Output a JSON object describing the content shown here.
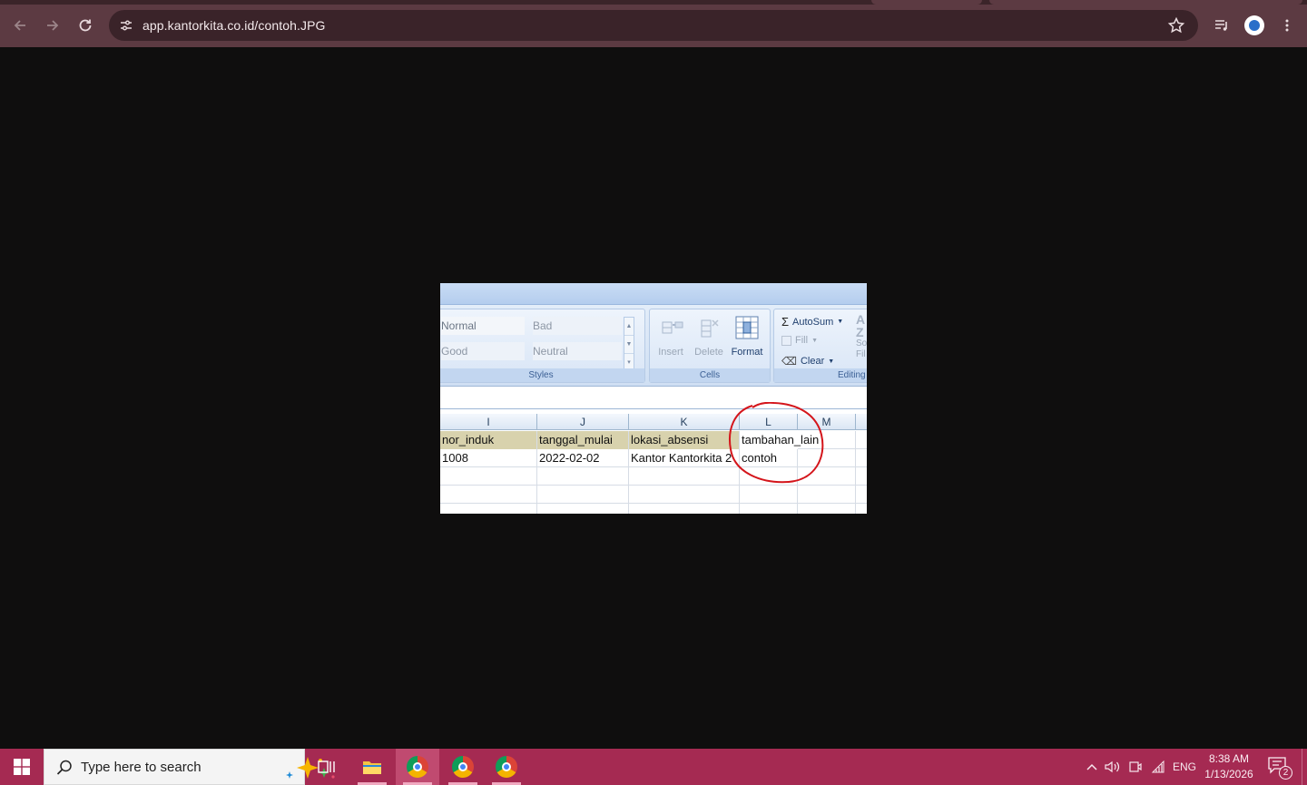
{
  "browser": {
    "url": "app.kantorkita.co.id/contoh.JPG",
    "icons": [
      "back-icon",
      "forward-icon",
      "reload-icon",
      "site-info-icon",
      "bookmark-star-icon",
      "media-control-icon",
      "profile-avatar",
      "menu-kebab-icon"
    ]
  },
  "excel": {
    "ribbon": {
      "styles": {
        "label": "Styles",
        "normal": "Normal",
        "bad": "Bad",
        "good": "Good",
        "neutral": "Neutral"
      },
      "cells": {
        "label": "Cells",
        "insert": "Insert",
        "delete": "Delete",
        "format": "Format"
      },
      "editing": {
        "label": "Editing",
        "autosum": "AutoSum",
        "fill": "Fill",
        "clear": "Clear",
        "sort_partial_1": "So",
        "sort_partial_2": "Fil"
      }
    },
    "columns": [
      "I",
      "J",
      "K",
      "L",
      "M"
    ],
    "header_row": [
      "nor_induk",
      "tanggal_mulai",
      "lokasi_absensi",
      "tambahan_lain",
      ""
    ],
    "data_row": [
      "1008",
      "2022-02-02",
      "Kantor Kantorkita 2",
      "contoh",
      ""
    ],
    "annotation_color": "#d4151b"
  },
  "taskbar": {
    "search_placeholder": "Type here to search",
    "tray": {
      "language": "ENG",
      "time": "8:38 AM",
      "date": "1/13/2026",
      "notifications": "2"
    },
    "accent": "#a52a52"
  }
}
